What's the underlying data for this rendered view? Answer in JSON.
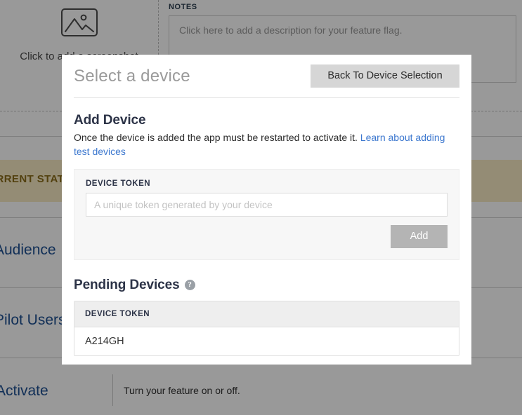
{
  "background": {
    "screenshot_uploader": {
      "icon": "image-placeholder-icon",
      "caption": "Click to add a screenshot"
    },
    "notes": {
      "label": "NOTES",
      "placeholder": "Click here to add a description for your feature flag."
    },
    "status_band": {
      "label": "CURRENT STATUS",
      "color": "#8a6d1a"
    },
    "rows": [
      {
        "title": "Audience"
      },
      {
        "title": "Pilot Users"
      }
    ],
    "activate": {
      "title": "Activate",
      "description": "Turn your feature on or off."
    },
    "link_color": "#1d4f91"
  },
  "modal": {
    "title": "Select a device",
    "back_button": "Back To Device Selection",
    "add_device": {
      "heading": "Add Device",
      "description": "Once the device is added the app must be restarted to activate it. ",
      "link_text": "Learn about adding test devices",
      "link_color": "#3d78cf",
      "field_label": "DEVICE TOKEN",
      "input_value": "",
      "input_placeholder": "A unique token generated by your device",
      "add_button": "Add",
      "add_button_color": "#b4b4b4"
    },
    "pending_devices": {
      "heading": "Pending Devices",
      "help_icon": "question-mark-icon",
      "help_glyph": "?",
      "column_header": "DEVICE TOKEN",
      "rows": [
        {
          "token": "A214GH"
        }
      ]
    }
  }
}
